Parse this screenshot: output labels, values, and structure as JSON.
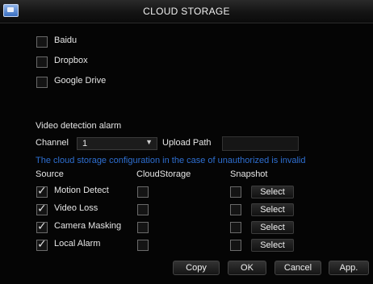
{
  "window": {
    "title": "CLOUD STORAGE"
  },
  "providers": [
    {
      "label": "Baidu",
      "checked": false
    },
    {
      "label": "Dropbox",
      "checked": false
    },
    {
      "label": "Google Drive",
      "checked": false
    }
  ],
  "video_alarm": {
    "section_label": "Video detection alarm",
    "channel_label": "Channel",
    "channel_value": "1",
    "upload_path_label": "Upload Path",
    "upload_path_value": "",
    "warning": "The cloud storage configuration in the case of unauthorized is invalid",
    "columns": {
      "source": "Source",
      "cloud": "CloudStorage",
      "snapshot": "Snapshot"
    },
    "rows": [
      {
        "source": "Motion Detect",
        "source_checked": true,
        "cloud_checked": false,
        "snapshot_checked": false,
        "select_label": "Select"
      },
      {
        "source": "Video Loss",
        "source_checked": true,
        "cloud_checked": false,
        "snapshot_checked": false,
        "select_label": "Select"
      },
      {
        "source": "Camera Masking",
        "source_checked": true,
        "cloud_checked": false,
        "snapshot_checked": false,
        "select_label": "Select"
      },
      {
        "source": "Local Alarm",
        "source_checked": true,
        "cloud_checked": false,
        "snapshot_checked": false,
        "select_label": "Select"
      }
    ]
  },
  "buttons": {
    "copy": "Copy",
    "ok": "OK",
    "cancel": "Cancel",
    "apply": "App."
  }
}
